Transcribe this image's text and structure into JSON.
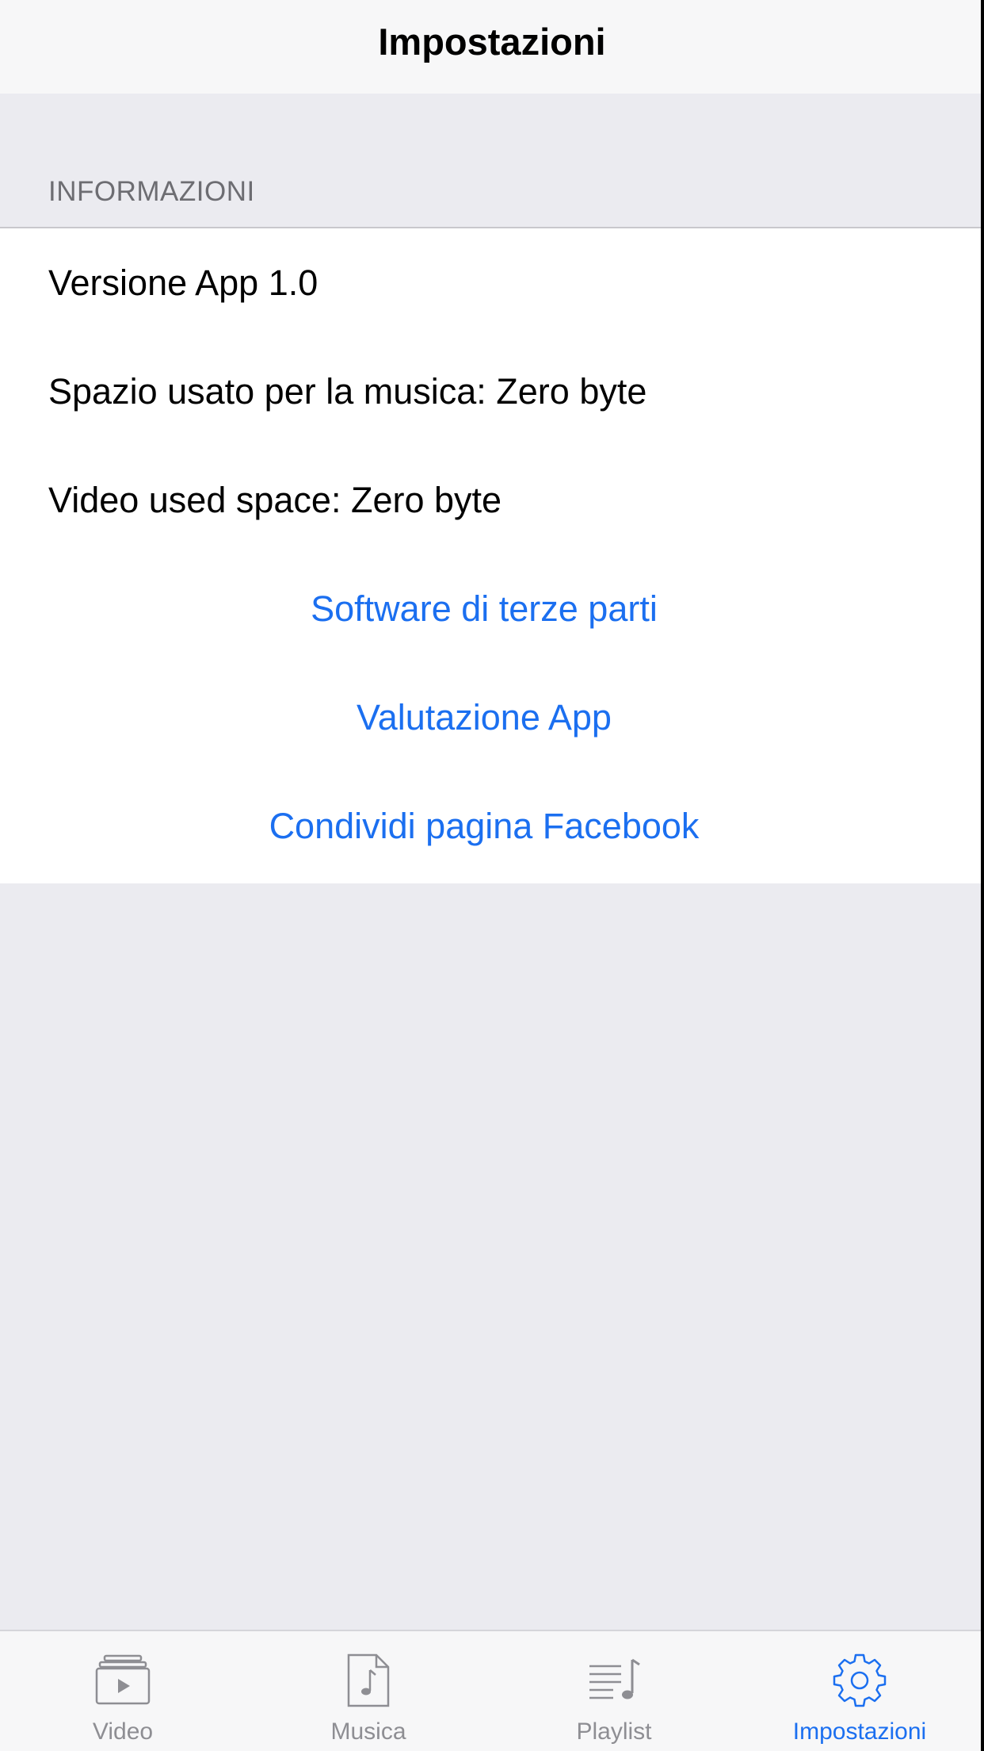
{
  "navbar": {
    "title": "Impostazioni"
  },
  "section": {
    "header": "INFORMAZIONI",
    "rows": [
      {
        "text": "Versione App 1.0"
      },
      {
        "text": "Spazio usato per la musica: Zero byte"
      },
      {
        "text": "Video used space: Zero byte"
      }
    ],
    "actions": [
      {
        "label": "Software di terze parti"
      },
      {
        "label": "Valutazione App"
      },
      {
        "label": "Condividi pagina Facebook"
      }
    ]
  },
  "tabbar": {
    "items": [
      {
        "label": "Video",
        "icon": "video-icon",
        "active": false
      },
      {
        "label": "Musica",
        "icon": "music-icon",
        "active": false
      },
      {
        "label": "Playlist",
        "icon": "playlist-icon",
        "active": false
      },
      {
        "label": "Impostazioni",
        "icon": "settings-gear-icon",
        "active": true
      }
    ]
  },
  "colors": {
    "accent": "#1b6ff0",
    "inactive": "#8e8e93",
    "background": "#ebebf0",
    "bar": "#f7f7f8"
  }
}
